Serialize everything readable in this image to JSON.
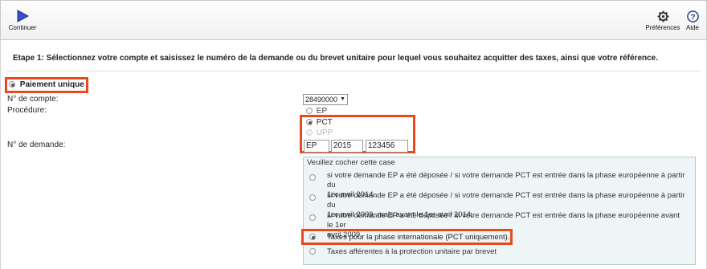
{
  "toolbar": {
    "continue_label": "Continuer",
    "preferences_label": "Préférences",
    "help_label": "Aide"
  },
  "step": {
    "title": "Etape 1: Sélectionnez votre compte et saisissez le numéro de la demande ou du brevet unitaire pour lequel vous souhaitez acquitter des taxes, ainsi que votre référence."
  },
  "payment": {
    "label": "Paiement unique",
    "selected": true
  },
  "account": {
    "label": "N° de compte:",
    "value": "28490000"
  },
  "procedure": {
    "label": "Procédure:",
    "options": [
      {
        "label": "EP",
        "selected": false,
        "disabled": false
      },
      {
        "label": "PCT",
        "selected": true,
        "disabled": false
      },
      {
        "label": "UPP",
        "selected": false,
        "disabled": true
      }
    ]
  },
  "application": {
    "label": "N° de demande:",
    "prefix": "EP",
    "year": "2015",
    "number": "123456"
  },
  "checkbox_panel": {
    "title": "Veuillez cocher cette case",
    "options": [
      {
        "line1": "si votre demande EP a été déposée / si votre demande PCT est entrée dans la phase européenne à partir du",
        "line2": "1er avril 2014.",
        "selected": false
      },
      {
        "line1": "si votre demande EP a été déposée / si votre demande PCT est entrée dans la phase européenne à partir du",
        "line2": "1er avril 2009, mais avant le 1er avril 2014.",
        "selected": false
      },
      {
        "line1": "si votre demande EP a été déposée / si votre demande PCT est entrée dans la phase européenne avant le 1er",
        "line2": "avril 2009.",
        "selected": false
      },
      {
        "line1": "Taxes pour la phase internationale (PCT uniquement).",
        "line2": "",
        "selected": true
      },
      {
        "line1": "Taxes afférentes à la protection unitaire par brevet",
        "line2": "",
        "selected": false
      }
    ]
  },
  "colors": {
    "highlight": "#e8491d",
    "continue_icon": "#3b4fd1",
    "panel_bg": "#eef5f6"
  }
}
